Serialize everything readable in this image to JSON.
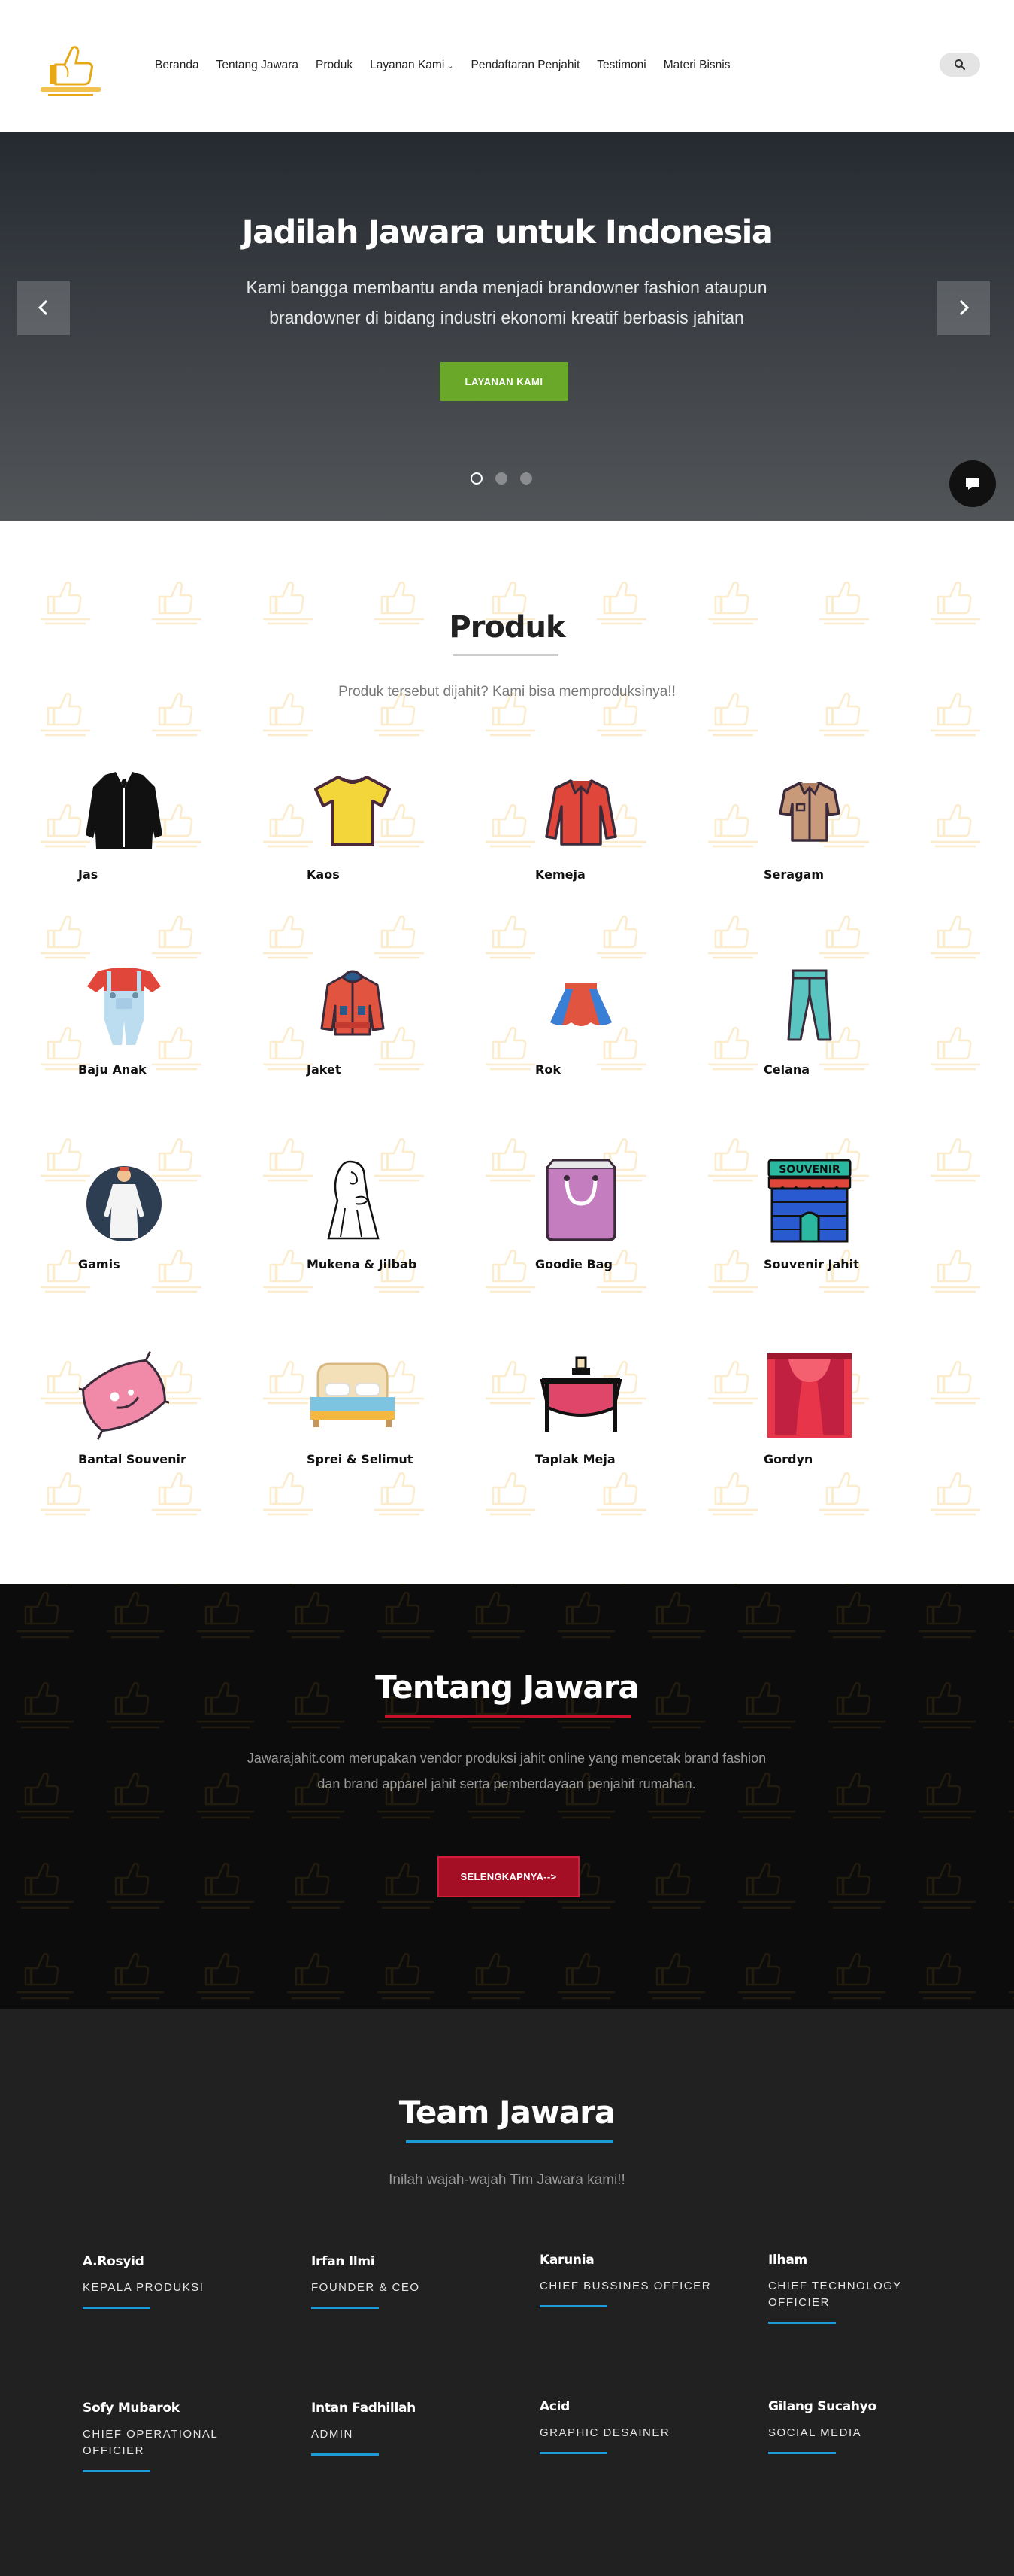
{
  "header": {
    "logo_alt": "Jawarajahit.com",
    "nav": [
      {
        "label": "Beranda",
        "has_dropdown": false
      },
      {
        "label": "Tentang Jawara",
        "has_dropdown": false
      },
      {
        "label": "Produk",
        "has_dropdown": false
      },
      {
        "label": "Layanan Kami",
        "has_dropdown": true
      },
      {
        "label": "Pendaftaran Penjahit",
        "has_dropdown": false
      },
      {
        "label": "Testimoni",
        "has_dropdown": false
      },
      {
        "label": "Materi Bisnis",
        "has_dropdown": false
      }
    ],
    "search_icon": "search-icon"
  },
  "hero": {
    "title": "Jadilah Jawara untuk Indonesia",
    "subtitle": "Kami bangga membantu anda menjadi brandowner fashion ataupun brandowner di bidang industri ekonomi kreatif berbasis jahitan",
    "cta_label": "LAYANAN KAMI",
    "cta_color": "#6aa82a",
    "slides_total": 3,
    "slide_active": 1
  },
  "produk": {
    "title": "Produk",
    "subtitle": "Produk tersebut dijahit? Kami bisa memproduksinya!!",
    "items": [
      {
        "label": "Jas",
        "icon": "suit-icon"
      },
      {
        "label": "Kaos",
        "icon": "tshirt-icon"
      },
      {
        "label": "Kemeja",
        "icon": "shirt-icon"
      },
      {
        "label": "Seragam",
        "icon": "uniform-icon"
      },
      {
        "label": "Baju Anak",
        "icon": "kids-overall-icon"
      },
      {
        "label": "Jaket",
        "icon": "jacket-icon"
      },
      {
        "label": "Rok",
        "icon": "skirt-icon"
      },
      {
        "label": "Celana",
        "icon": "pants-icon"
      },
      {
        "label": "Gamis",
        "icon": "gamis-icon"
      },
      {
        "label": "Mukena & Jilbab",
        "icon": "mukena-icon"
      },
      {
        "label": "Goodie Bag",
        "icon": "bag-icon"
      },
      {
        "label": "Souvenir Jahit",
        "icon": "souvenir-shop-icon"
      },
      {
        "label": "Bantal Souvenir",
        "icon": "pillow-icon"
      },
      {
        "label": "Sprei & Selimut",
        "icon": "bed-icon"
      },
      {
        "label": "Taplak Meja",
        "icon": "table-cloth-icon"
      },
      {
        "label": "Gordyn",
        "icon": "curtain-icon"
      }
    ],
    "souvenir_sign": "SOUVENIR"
  },
  "tentang": {
    "title": "Tentang Jawara",
    "text": "Jawarajahit.com merupakan vendor produksi jahit online yang mencetak brand fashion dan brand apparel jahit serta pemberdayaan penjahit rumahan.",
    "button_label": "SELENGKAPNYA-->",
    "accent_color": "#c8102e"
  },
  "team": {
    "title": "Team Jawara",
    "subtitle": "Inilah wajah-wajah Tim Jawara kami!!",
    "accent_color": "#1e9ad6",
    "members": [
      {
        "name": "A.Rosyid",
        "role": "KEPALA PRODUKSI"
      },
      {
        "name": "Irfan Ilmi",
        "role": "FOUNDER & CEO"
      },
      {
        "name": "Karunia",
        "role": "CHIEF BUSSINES OFFICER"
      },
      {
        "name": "Ilham",
        "role": "CHIEF TECHNOLOGY OFFICIER"
      },
      {
        "name": "Sofy Mubarok",
        "role": "CHIEF OPERATIONAL OFFICIER"
      },
      {
        "name": "Intan Fadhillah",
        "role": "ADMIN"
      },
      {
        "name": "Acid",
        "role": "GRAPHIC DESAINER"
      },
      {
        "name": "Gilang Sucahyo",
        "role": "SOCIAL MEDIA"
      }
    ]
  }
}
